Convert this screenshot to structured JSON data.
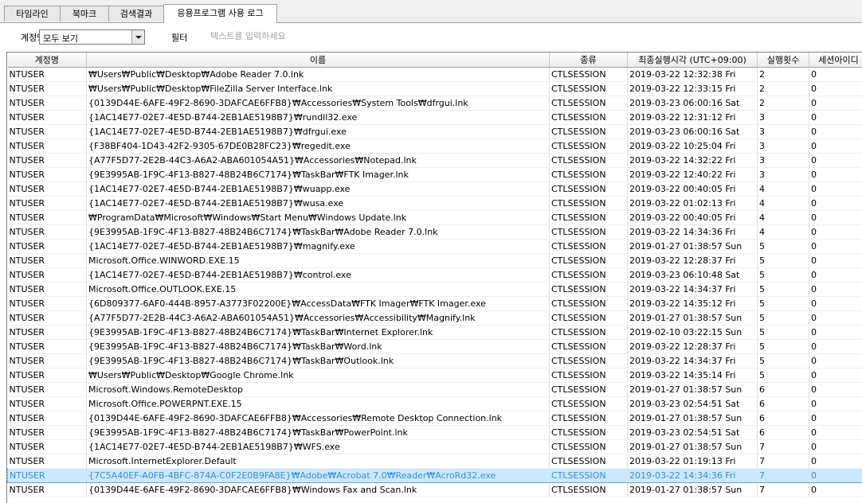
{
  "tabs": [
    {
      "label": "타임라인"
    },
    {
      "label": "북마크"
    },
    {
      "label": "검색결과"
    },
    {
      "label": "응용프로그램 사용 로그",
      "active": true
    }
  ],
  "filter": {
    "account_label": "계정명",
    "account_value": "모두 보기",
    "filter_label": "필터",
    "text_placeholder": "텍스트를 입력하세요"
  },
  "table": {
    "columns": [
      "계정명",
      "이름",
      "종류",
      "최종실행시각 (UTC+09:00)",
      "실행횟수",
      "세션아이디"
    ],
    "selected_row": 28,
    "rows": [
      [
        "NTUSER",
        "₩Users₩Public₩Desktop₩Adobe Reader 7.0.lnk",
        "CTLSESSION",
        "2019-03-22  12:32:38  Fri",
        "2",
        "0"
      ],
      [
        "NTUSER",
        "₩Users₩Public₩Desktop₩FileZilla Server Interface.lnk",
        "CTLSESSION",
        "2019-03-22  12:33:15  Fri",
        "2",
        "0"
      ],
      [
        "NTUSER",
        "{0139D44E-6AFE-49F2-8690-3DAFCAE6FFB8}₩Accessories₩System Tools₩dfrgui.lnk",
        "CTLSESSION",
        "2019-03-23  06:00:16  Sat",
        "2",
        "0"
      ],
      [
        "NTUSER",
        "{1AC14E77-02E7-4E5D-B744-2EB1AE5198B7}₩rundll32.exe",
        "CTLSESSION",
        "2019-03-22  12:31:12  Fri",
        "3",
        "0"
      ],
      [
        "NTUSER",
        "{1AC14E77-02E7-4E5D-B744-2EB1AE5198B7}₩dfrgui.exe",
        "CTLSESSION",
        "2019-03-23  06:00:16  Sat",
        "3",
        "0"
      ],
      [
        "NTUSER",
        "{F38BF404-1D43-42F2-9305-67DE0B28FC23}₩regedit.exe",
        "CTLSESSION",
        "2019-03-22  10:25:04  Fri",
        "3",
        "0"
      ],
      [
        "NTUSER",
        "{A77F5D77-2E2B-44C3-A6A2-ABA601054A51}₩Accessories₩Notepad.lnk",
        "CTLSESSION",
        "2019-03-22  14:32:22  Fri",
        "3",
        "0"
      ],
      [
        "NTUSER",
        "{9E3995AB-1F9C-4F13-B827-48B24B6C7174}₩TaskBar₩FTK Imager.lnk",
        "CTLSESSION",
        "2019-03-22  12:40:22  Fri",
        "3",
        "0"
      ],
      [
        "NTUSER",
        "{1AC14E77-02E7-4E5D-B744-2EB1AE5198B7}₩wuapp.exe",
        "CTLSESSION",
        "2019-03-22  00:40:05  Fri",
        "4",
        "0"
      ],
      [
        "NTUSER",
        "{1AC14E77-02E7-4E5D-B744-2EB1AE5198B7}₩wusa.exe",
        "CTLSESSION",
        "2019-03-22  01:02:13  Fri",
        "4",
        "0"
      ],
      [
        "NTUSER",
        "₩ProgramData₩Microsoft₩Windows₩Start Menu₩Windows Update.lnk",
        "CTLSESSION",
        "2019-03-22  00:40:05  Fri",
        "4",
        "0"
      ],
      [
        "NTUSER",
        "{9E3995AB-1F9C-4F13-B827-48B24B6C7174}₩TaskBar₩Adobe Reader 7.0.lnk",
        "CTLSESSION",
        "2019-03-22  14:34:36  Fri",
        "4",
        "0"
      ],
      [
        "NTUSER",
        "{1AC14E77-02E7-4E5D-B744-2EB1AE5198B7}₩magnify.exe",
        "CTLSESSION",
        "2019-01-27  01:38:57  Sun",
        "5",
        "0"
      ],
      [
        "NTUSER",
        "Microsoft.Office.WINWORD.EXE.15",
        "CTLSESSION",
        "2019-03-22  12:28:37  Fri",
        "5",
        "0"
      ],
      [
        "NTUSER",
        "{1AC14E77-02E7-4E5D-B744-2EB1AE5198B7}₩control.exe",
        "CTLSESSION",
        "2019-03-23  06:10:48  Sat",
        "5",
        "0"
      ],
      [
        "NTUSER",
        "Microsoft.Office.OUTLOOK.EXE.15",
        "CTLSESSION",
        "2019-03-22  14:34:37  Fri",
        "5",
        "0"
      ],
      [
        "NTUSER",
        "{6D809377-6AF0-444B-8957-A3773F02200E}₩AccessData₩FTK Imager₩FTK Imager.exe",
        "CTLSESSION",
        "2019-03-22  14:35:12  Fri",
        "5",
        "0"
      ],
      [
        "NTUSER",
        "{A77F5D77-2E2B-44C3-A6A2-ABA601054A51}₩Accessories₩Accessibility₩Magnify.lnk",
        "CTLSESSION",
        "2019-01-27  01:38:57  Sun",
        "5",
        "0"
      ],
      [
        "NTUSER",
        "{9E3995AB-1F9C-4F13-B827-48B24B6C7174}₩TaskBar₩Internet Explorer.lnk",
        "CTLSESSION",
        "2019-02-10  03:22:15  Sun",
        "5",
        "0"
      ],
      [
        "NTUSER",
        "{9E3995AB-1F9C-4F13-B827-48B24B6C7174}₩TaskBar₩Word.lnk",
        "CTLSESSION",
        "2019-03-22  12:28:37  Fri",
        "5",
        "0"
      ],
      [
        "NTUSER",
        "{9E3995AB-1F9C-4F13-B827-48B24B6C7174}₩TaskBar₩Outlook.lnk",
        "CTLSESSION",
        "2019-03-22  14:34:37  Fri",
        "5",
        "0"
      ],
      [
        "NTUSER",
        "₩Users₩Public₩Desktop₩Google Chrome.lnk",
        "CTLSESSION",
        "2019-03-22  14:35:14  Fri",
        "5",
        "0"
      ],
      [
        "NTUSER",
        "Microsoft.Windows.RemoteDesktop",
        "CTLSESSION",
        "2019-01-27  01:38:57  Sun",
        "6",
        "0"
      ],
      [
        "NTUSER",
        "Microsoft.Office.POWERPNT.EXE.15",
        "CTLSESSION",
        "2019-03-23  02:54:51  Sat",
        "6",
        "0"
      ],
      [
        "NTUSER",
        "{0139D44E-6AFE-49F2-8690-3DAFCAE6FFB8}₩Accessories₩Remote Desktop Connection.lnk",
        "CTLSESSION",
        "2019-01-27  01:38:57  Sun",
        "6",
        "0"
      ],
      [
        "NTUSER",
        "{9E3995AB-1F9C-4F13-B827-48B24B6C7174}₩TaskBar₩PowerPoint.lnk",
        "CTLSESSION",
        "2019-03-23  02:54:51  Sat",
        "6",
        "0"
      ],
      [
        "NTUSER",
        "{1AC14E77-02E7-4E5D-B744-2EB1AE5198B7}₩WFS.exe",
        "CTLSESSION",
        "2019-01-27  01:38:57  Sun",
        "7",
        "0"
      ],
      [
        "NTUSER",
        "Microsoft.InternetExplorer.Default",
        "CTLSESSION",
        "2019-03-22  01:19:13  Fri",
        "7",
        "0"
      ],
      [
        "NTUSER",
        "{7C5A40EF-A0FB-4BFC-874A-C0F2E0B9FA8E}₩Adobe₩Acrobat 7.0₩Reader₩AcroRd32.exe",
        "CTLSESSION",
        "2019-03-22  14:34:36  Fri",
        "7",
        "0"
      ],
      [
        "NTUSER",
        "{0139D44E-6AFE-49F2-8690-3DAFCAE6FFB8}₩Windows Fax and Scan.lnk",
        "CTLSESSION",
        "2019-01-27  01:38:57  Sun",
        "7",
        "0"
      ]
    ]
  }
}
